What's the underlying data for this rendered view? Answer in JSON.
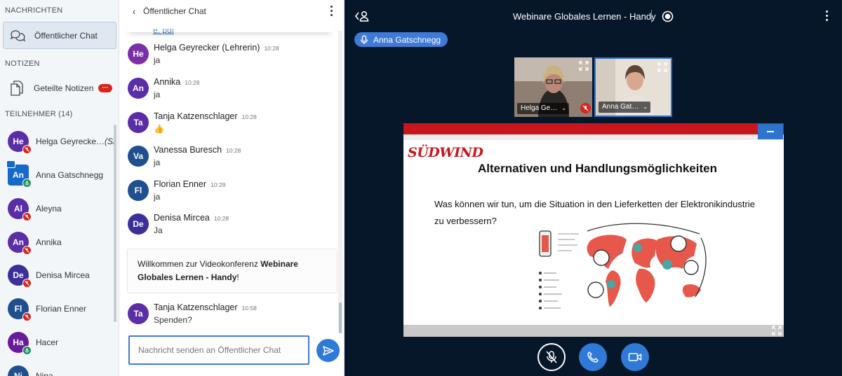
{
  "colors": {
    "accent": "#2f79d8",
    "main_bg": "#06172a",
    "slide_red": "#c9161e",
    "muted_badge": "#d8241c",
    "unmuted_badge": "#1a8e59"
  },
  "sidebar": {
    "messages_title": "NACHRICHTEN",
    "public_chat_label": "Öffentlicher Chat",
    "notes_title": "NOTIZEN",
    "shared_notes_label": "Geteilte Notizen",
    "shared_notes_badge": "···",
    "participants_title": "TEILNEHMER (14)",
    "participants": [
      {
        "initials": "He",
        "name": "Helga Geyrecke…",
        "suffix": "(Sie)",
        "color": "#5b2da6",
        "square": false,
        "mic": "muted",
        "presenter": false
      },
      {
        "initials": "An",
        "name": "Anna Gatschnegg",
        "suffix": "",
        "color": "#1769c9",
        "square": true,
        "mic": "unmuted",
        "presenter": true
      },
      {
        "initials": "Al",
        "name": "Aleyna",
        "suffix": "",
        "color": "#5b2da6",
        "square": false,
        "mic": "muted",
        "presenter": false
      },
      {
        "initials": "An",
        "name": "Annika",
        "suffix": "",
        "color": "#5b2da6",
        "square": false,
        "mic": "muted",
        "presenter": false
      },
      {
        "initials": "De",
        "name": "Denisa Mircea",
        "suffix": "",
        "color": "#3c2f99",
        "square": false,
        "mic": "muted",
        "presenter": false
      },
      {
        "initials": "Fl",
        "name": "Florian Enner",
        "suffix": "",
        "color": "#1f4f8f",
        "square": false,
        "mic": "muted",
        "presenter": false
      },
      {
        "initials": "Ha",
        "name": "Hacer",
        "suffix": "",
        "color": "#6a1b9a",
        "square": false,
        "mic": "unmuted",
        "presenter": false
      },
      {
        "initials": "Ni",
        "name": "Nina",
        "suffix": "",
        "color": "#1f4f8f",
        "square": false,
        "mic": "none",
        "presenter": false
      }
    ]
  },
  "chat": {
    "back_label": "‹",
    "title": "Öffentlicher Chat",
    "messages": [
      {
        "initials": "He",
        "color": "#7b2fa8",
        "name": "Helga Geyrecker (Lehrerin)",
        "time": "10:28",
        "text": "ja"
      },
      {
        "initials": "An",
        "color": "#5b2da6",
        "name": "Annika",
        "time": "10:28",
        "text": "ja"
      },
      {
        "initials": "Ta",
        "color": "#5b2da6",
        "name": "Tanja Katzenschlager",
        "time": "10:28",
        "text": "👍"
      },
      {
        "initials": "Va",
        "color": "#1f4f8f",
        "name": "Vanessa Buresch",
        "time": "10:28",
        "text": "ja"
      },
      {
        "initials": "Fl",
        "color": "#1f4f8f",
        "name": "Florian Enner",
        "time": "10:28",
        "text": "ja"
      },
      {
        "initials": "De",
        "color": "#3c2f99",
        "name": "Denisa Mircea",
        "time": "10:28",
        "text": "Ja"
      }
    ],
    "welcome_prefix": "Willkommen zur Videokonferenz ",
    "welcome_room": "Webinare Globales Lernen - Handy",
    "welcome_suffix": "!",
    "last_message": {
      "initials": "Ta",
      "color": "#5b2da6",
      "name": "Tanja Katzenschlager",
      "time": "10:58",
      "text": "Spenden?"
    },
    "input_placeholder": "Nachricht senden an Öffentlicher Chat"
  },
  "main": {
    "title": "Webinare Globales Lernen - Handy",
    "active_speaker": "Anna Gatschnegg",
    "cameras": [
      {
        "name": "Helga Ge…",
        "muted": true
      },
      {
        "name": "Anna Gat…",
        "muted": false
      }
    ],
    "slide": {
      "logo": "SÜDWIND",
      "heading": "Alternativen und Handlungsmöglichkeiten",
      "question": "Was können wir tun, um die Situation in den Lieferketten der Elektronikindustrie zu verbessern?"
    }
  }
}
